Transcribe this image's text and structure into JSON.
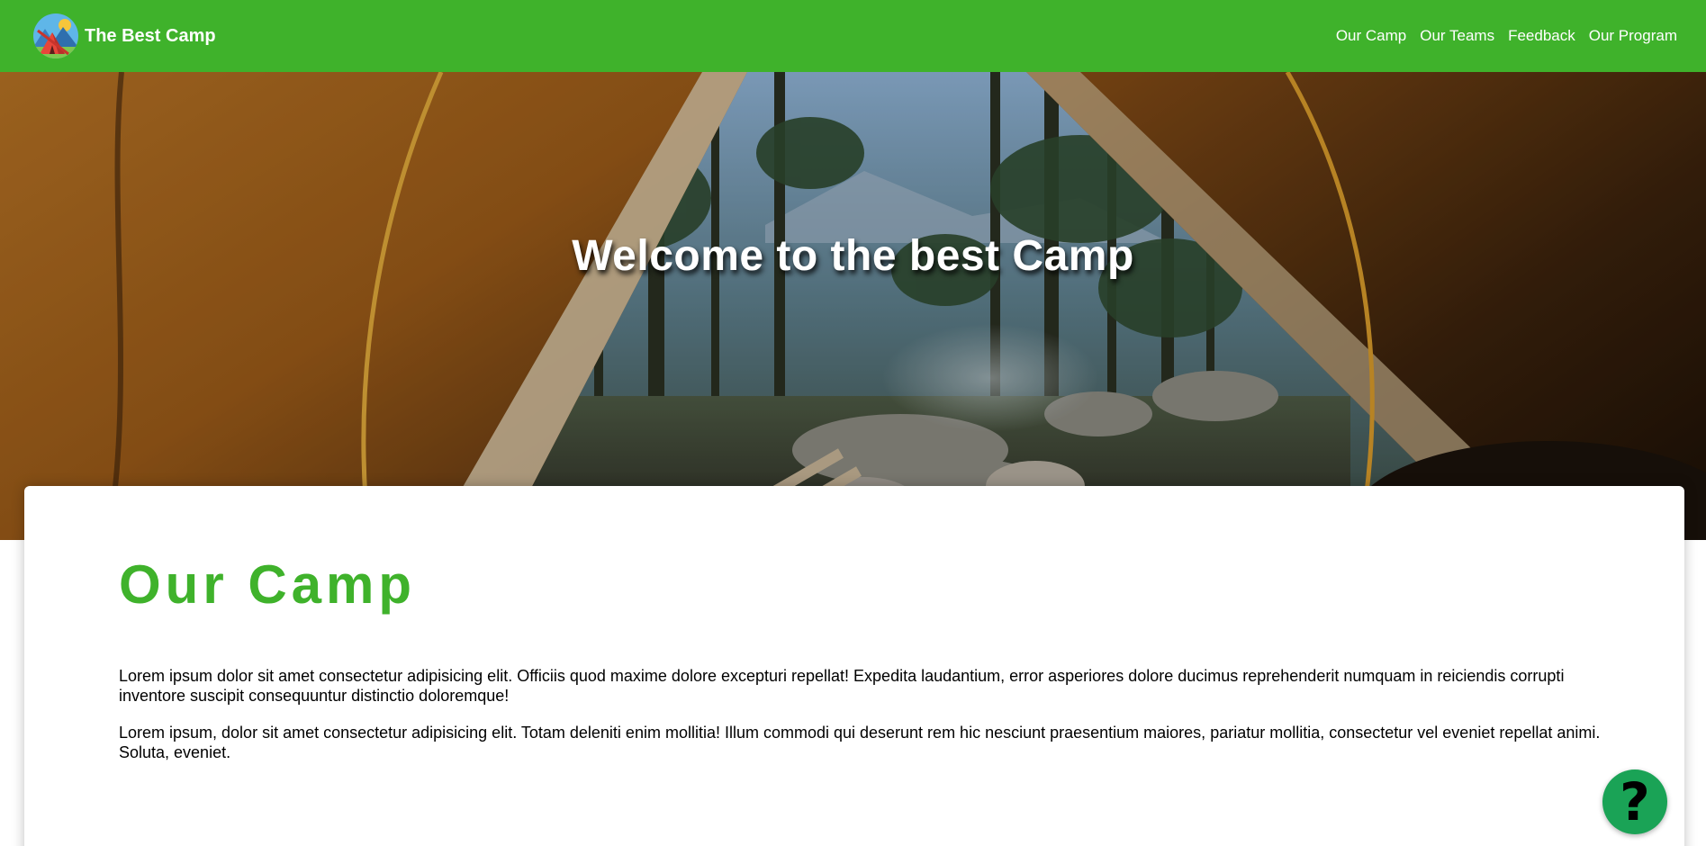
{
  "header": {
    "brand_name": "The Best Camp",
    "logo_icon": "camp-tent-logo",
    "nav": [
      {
        "label": "Our Camp"
      },
      {
        "label": "Our Teams"
      },
      {
        "label": "Feedback"
      },
      {
        "label": "Our Program"
      }
    ],
    "background_color": "#3fb22b"
  },
  "hero": {
    "title": "Welcome to the best Camp",
    "image": "tent-opening-forest-campfire"
  },
  "section": {
    "title": "Our Camp",
    "title_color": "#3fb22b",
    "paragraphs": [
      "Lorem ipsum dolor sit amet consectetur adipisicing elit. Officiis quod maxime dolore excepturi repellat! Expedita laudantium, error asperiores dolore ducimus reprehenderit numquam in reiciendis corrupti inventore suscipit consequuntur distinctio doloremque!",
      "Lorem ipsum, dolor sit amet consectetur adipisicing elit. Totam deleniti enim mollitia! Illum commodi qui deserunt rem hic nesciunt praesentium maiores, pariatur mollitia, consectetur vel eveniet repellat animi. Soluta, eveniet."
    ]
  },
  "help_button": {
    "glyph": "?",
    "icon": "question-mark-icon",
    "color": "#1aa356"
  }
}
